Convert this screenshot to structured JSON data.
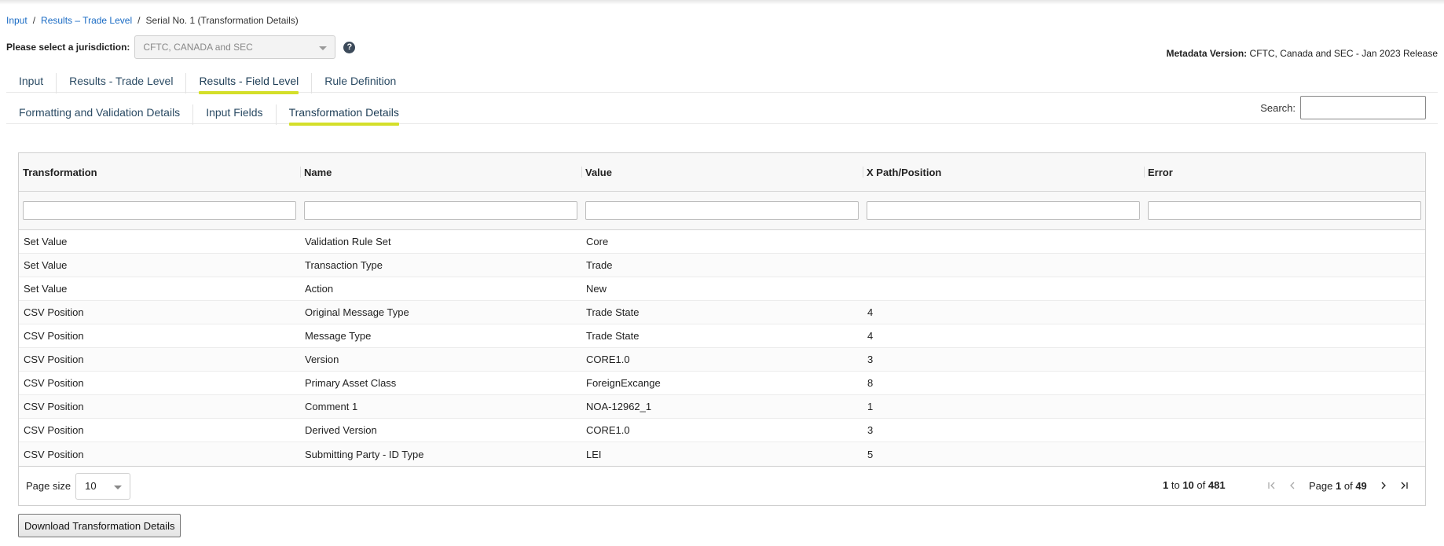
{
  "breadcrumb": {
    "items": [
      "Input",
      "Results – Trade Level"
    ],
    "current": "Serial No. 1 (Transformation Details)",
    "separator": "/"
  },
  "jurisdiction": {
    "label": "Please select a jurisdiction:",
    "selected": "CFTC, CANADA and SEC",
    "help_icon": "?"
  },
  "metadata": {
    "label": "Metadata Version:",
    "value": "CFTC, Canada and SEC - Jan 2023 Release"
  },
  "main_tabs": [
    {
      "label": "Input",
      "active": false
    },
    {
      "label": "Results - Trade Level",
      "active": false
    },
    {
      "label": "Results - Field Level",
      "active": true
    },
    {
      "label": "Rule Definition",
      "active": false
    }
  ],
  "sub_tabs": [
    {
      "label": "Formatting and Validation Details",
      "active": false
    },
    {
      "label": "Input Fields",
      "active": false
    },
    {
      "label": "Transformation Details",
      "active": true
    }
  ],
  "search": {
    "label": "Search:",
    "value": ""
  },
  "table": {
    "columns": [
      "Transformation",
      "Name",
      "Value",
      "X Path/Position",
      "Error"
    ],
    "rows": [
      [
        "Set Value",
        "Validation Rule Set",
        "Core",
        "",
        ""
      ],
      [
        "Set Value",
        "Transaction Type",
        "Trade",
        "",
        ""
      ],
      [
        "Set Value",
        "Action",
        "New",
        "",
        ""
      ],
      [
        "CSV Position",
        "Original Message Type",
        "Trade State",
        "4",
        ""
      ],
      [
        "CSV Position",
        "Message Type",
        "Trade State",
        "4",
        ""
      ],
      [
        "CSV Position",
        "Version",
        "CORE1.0",
        "3",
        ""
      ],
      [
        "CSV Position",
        "Primary Asset Class",
        "ForeignExcange",
        "8",
        ""
      ],
      [
        "CSV Position",
        "Comment 1",
        "NOA-12962_1",
        "1",
        ""
      ],
      [
        "CSV Position",
        "Derived Version",
        "CORE1.0",
        "3",
        ""
      ],
      [
        "CSV Position",
        "Submitting Party - ID Type",
        "LEI",
        "5",
        ""
      ]
    ]
  },
  "pagination": {
    "page_size_label": "Page size",
    "page_size": "10",
    "from": "1",
    "to_word": "to",
    "to": "10",
    "of_word": "of",
    "total": "481",
    "page_word": "Page",
    "page": "1",
    "pages": "49",
    "icons": {
      "first": "first-page-icon",
      "prev": "previous-page-icon",
      "next": "next-page-icon",
      "last": "last-page-icon"
    }
  },
  "download_label": "Download Transformation Details",
  "colors": {
    "link": "#1a6bc4",
    "tab_text": "#2b4b64",
    "active_underline": "#d4df2a"
  }
}
